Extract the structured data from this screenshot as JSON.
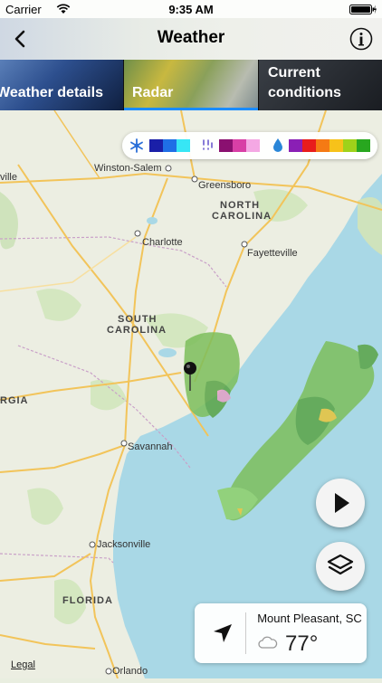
{
  "status": {
    "carrier": "Carrier",
    "time": "9:35 AM"
  },
  "nav": {
    "title": "Weather"
  },
  "tabs": [
    {
      "label": "Weather details"
    },
    {
      "label": "Radar"
    },
    {
      "label_line1": "Current",
      "label_line2": "conditions"
    }
  ],
  "legend": {
    "snow": [
      "#1a1fa8",
      "#1f6fe6",
      "#37e6f5"
    ],
    "mix": [
      "#8a1070",
      "#d83fa6",
      "#f4a8e4"
    ],
    "rain": [
      "#8a1fb5",
      "#e81c1c",
      "#f57a14",
      "#f7c21a",
      "#9fd21a",
      "#28a71f"
    ]
  },
  "map": {
    "cities": [
      "Winston-Salem",
      "Greensboro",
      "Charlotte",
      "Fayetteville",
      "Savannah",
      "Jacksonville",
      "Orlando"
    ],
    "states": [
      "NORTH",
      "CAROLINA",
      "SOUTH",
      "CAROLINA",
      "FLORIDA",
      "RGIA"
    ],
    "edge_text": "ville"
  },
  "card": {
    "location": "Mount Pleasant, SC",
    "temperature": "77°"
  },
  "legal": "Legal"
}
